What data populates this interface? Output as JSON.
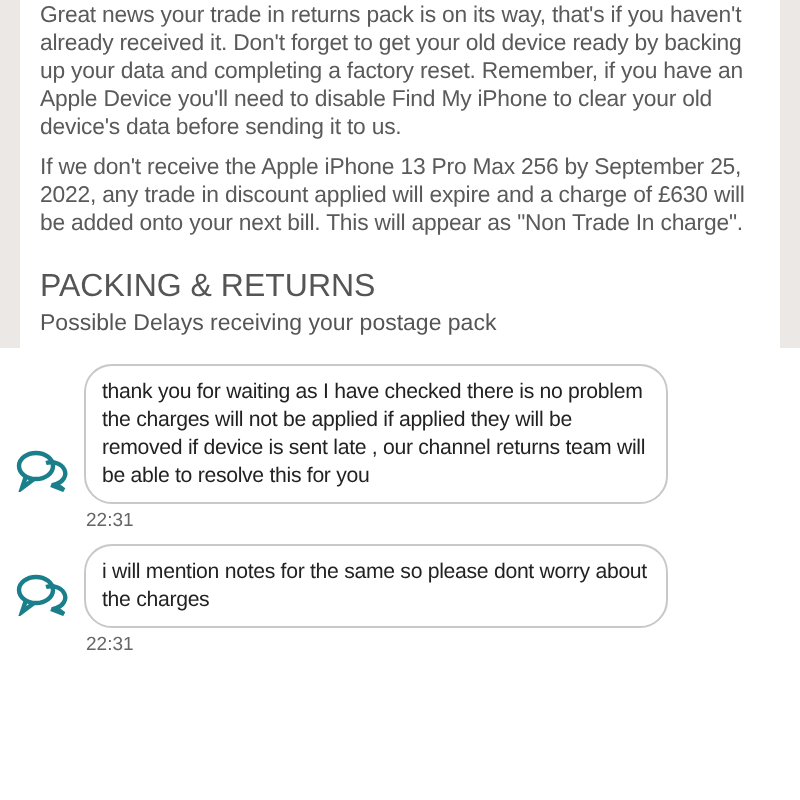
{
  "notice": {
    "paragraphs": [
      "Great news your trade in returns pack is on its way, that's if you haven't already received it. Don't forget to get your old device ready by backing up your data and completing a factory reset. Remember, if you have an Apple Device you'll need to disable Find My iPhone to clear your old device's data before sending it to us.",
      "If we don't receive the Apple iPhone 13 Pro Max 256 by September 25, 2022, any trade in discount applied will expire and a charge of £630 will be added onto your next bill. This will appear as \"Non Trade In charge\"."
    ],
    "heading": "PACKING & RETURNS",
    "subheading": "Possible Delays receiving your postage pack"
  },
  "chat": [
    {
      "text": "thank you for waiting as I have checked there is no problem the charges will not be applied if applied they will be removed if device is sent late , our channel returns team will be able to resolve this for you",
      "time": "22:31"
    },
    {
      "text": "i will mention notes for the same so please dont worry about the charges",
      "time": "22:31"
    }
  ]
}
